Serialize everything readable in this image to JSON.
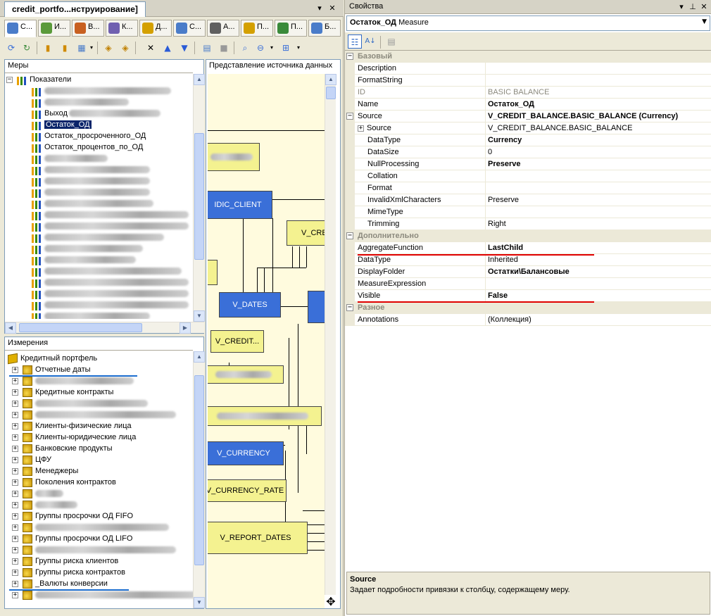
{
  "doc": {
    "tab_title": "credit_portfo...нструирование]"
  },
  "designer_tabs": [
    {
      "label": "С...",
      "color": "#4a7cc9"
    },
    {
      "label": "И...",
      "color": "#5a9a3a"
    },
    {
      "label": "В...",
      "color": "#c86020"
    },
    {
      "label": "К...",
      "color": "#7060b0"
    },
    {
      "label": "Д...",
      "color": "#d4a000"
    },
    {
      "label": "С...",
      "color": "#4a7cc9"
    },
    {
      "label": "А...",
      "color": "#606060"
    },
    {
      "label": "П...",
      "color": "#d4a000"
    },
    {
      "label": "П...",
      "color": "#3a8a3a"
    },
    {
      "label": "Б...",
      "color": "#4a7cc9"
    }
  ],
  "measures": {
    "title": "Меры",
    "root": "Показатели",
    "items": [
      {
        "label": "",
        "blurred": true,
        "w": 180
      },
      {
        "label": "",
        "blurred": true,
        "w": 120
      },
      {
        "label": "Выход",
        "blurred": true,
        "w": 130
      },
      {
        "label": "Остаток_ОД",
        "selected": true
      },
      {
        "label": "Остаток_просроченного_ОД"
      },
      {
        "label": "Остаток_процентов_по_ОД"
      },
      {
        "label": "",
        "blurred": true,
        "w": 90
      },
      {
        "label": "",
        "blurred": true,
        "w": 150
      },
      {
        "label": "",
        "blurred": true,
        "w": 150
      },
      {
        "label": "",
        "blurred": true,
        "w": 150
      },
      {
        "label": "",
        "blurred": true,
        "w": 155
      },
      {
        "label": "",
        "blurred": true,
        "w": 205
      },
      {
        "label": "",
        "blurred": true,
        "w": 205
      },
      {
        "label": "",
        "blurred": true,
        "w": 170
      },
      {
        "label": "",
        "blurred": true,
        "w": 140
      },
      {
        "label": "",
        "blurred": true,
        "w": 130
      },
      {
        "label": "",
        "blurred": true,
        "w": 195
      },
      {
        "label": "",
        "blurred": true,
        "w": 205
      },
      {
        "label": "",
        "blurred": true,
        "w": 205
      },
      {
        "label": "",
        "blurred": true,
        "w": 205
      },
      {
        "label": "",
        "blurred": true,
        "w": 150
      }
    ]
  },
  "dims": {
    "title": "Измерения",
    "root": "Кредитный портфель",
    "items": [
      {
        "label": "Отчетные даты"
      },
      {
        "label": "",
        "blurred": true,
        "w": 140
      },
      {
        "label": "Кредитные контракты"
      },
      {
        "label": "",
        "blurred": true,
        "w": 160
      },
      {
        "label": "",
        "blurred": true,
        "w": 200
      },
      {
        "label": "Клиенты-физические лица"
      },
      {
        "label": "Клиенты-юридические лица"
      },
      {
        "label": "Банковские продукты"
      },
      {
        "label": "ЦФУ"
      },
      {
        "label": "Менеджеры"
      },
      {
        "label": "Поколения контрактов"
      },
      {
        "label": "",
        "blurred": true,
        "w": 40
      },
      {
        "label": "",
        "blurred": true,
        "w": 60
      },
      {
        "label": "Группы просрочки ОД FIFO"
      },
      {
        "label": "",
        "blurred": true,
        "w": 190
      },
      {
        "label": "Группы просрочки ОД LIFO"
      },
      {
        "label": "",
        "blurred": true,
        "w": 200
      },
      {
        "label": "Группы риска клиентов"
      },
      {
        "label": "Группы риска контрактов"
      },
      {
        "label": "_Валюты конверсии"
      },
      {
        "label": "",
        "blurred": true,
        "w": 230
      }
    ]
  },
  "dsv": {
    "title": "Представление источника данных",
    "tables": [
      {
        "label": "",
        "blurred": true
      },
      {
        "label": "IDIC_CLIENT"
      },
      {
        "label": "V_CRE"
      },
      {
        "label": ""
      },
      {
        "label": "V_DATES"
      },
      {
        "label": ""
      },
      {
        "label": "V_CREDIT..."
      },
      {
        "label": "",
        "blurred": true
      },
      {
        "label": "",
        "blurred": true
      },
      {
        "label": "V_CURRENCY"
      },
      {
        "label": "V_CURRENCY_RATE"
      },
      {
        "label": "V_REPORT_DATES"
      }
    ]
  },
  "props": {
    "panel_title": "Свойства",
    "object_name": "Остаток_ОД",
    "object_type": "Measure",
    "rows": [
      {
        "kind": "cat",
        "name": "Базовый"
      },
      {
        "name": "Description",
        "value": ""
      },
      {
        "name": "FormatString",
        "value": ""
      },
      {
        "name": "ID",
        "value": "BASIC BALANCE",
        "gray": true
      },
      {
        "name": "Name",
        "value": "Остаток_ОД",
        "bold": true
      },
      {
        "name": "Source",
        "value": "V_CREDIT_BALANCE.BASIC_BALANCE (Currency)",
        "bold": true,
        "expander": "minus"
      },
      {
        "name": "Source",
        "value": "V_CREDIT_BALANCE.BASIC_BALANCE",
        "indent": 1,
        "expander": "plus"
      },
      {
        "name": "DataType",
        "value": "Currency",
        "bold": true,
        "indent": 1
      },
      {
        "name": "DataSize",
        "value": "0",
        "indent": 1
      },
      {
        "name": "NullProcessing",
        "value": "Preserve",
        "bold": true,
        "indent": 1
      },
      {
        "name": "Collation",
        "value": "",
        "indent": 1
      },
      {
        "name": "Format",
        "value": "",
        "indent": 1
      },
      {
        "name": "InvalidXmlCharacters",
        "value": "Preserve",
        "indent": 1
      },
      {
        "name": "MimeType",
        "value": "",
        "indent": 1
      },
      {
        "name": "Trimming",
        "value": "Right",
        "indent": 1
      },
      {
        "kind": "cat",
        "name": "Дополнительно"
      },
      {
        "name": "AggregateFunction",
        "value": "LastChild",
        "bold": true,
        "red": true
      },
      {
        "name": "DataType",
        "value": "Inherited"
      },
      {
        "name": "DisplayFolder",
        "value": "Остатки\\Балансовые",
        "bold": true
      },
      {
        "name": "MeasureExpression",
        "value": ""
      },
      {
        "name": "Visible",
        "value": "False",
        "bold": true,
        "red": true
      },
      {
        "kind": "cat",
        "name": "Разное"
      },
      {
        "name": "Annotations",
        "value": "(Коллекция)"
      }
    ],
    "desc_title": "Source",
    "desc_text": "Задает подробности привязки к столбцу, содержащему меру."
  }
}
